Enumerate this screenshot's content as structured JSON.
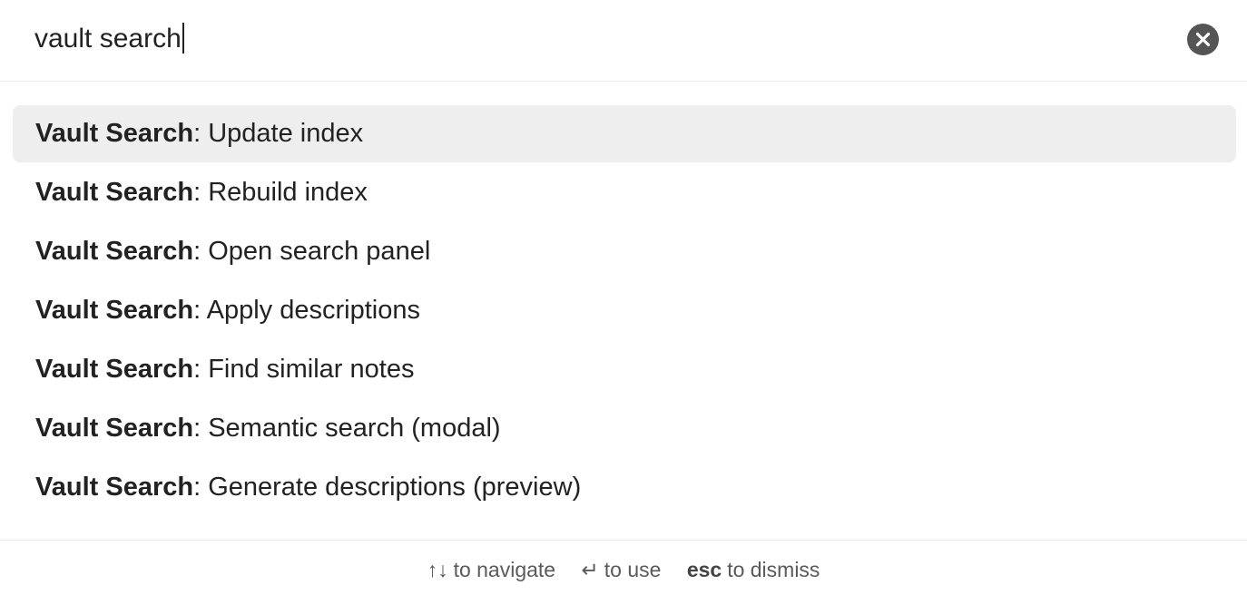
{
  "search": {
    "value": "vault search",
    "clear_icon": "close-icon"
  },
  "results": [
    {
      "prefix": "Vault Search",
      "label": ": Update index",
      "selected": true
    },
    {
      "prefix": "Vault Search",
      "label": ": Rebuild index",
      "selected": false
    },
    {
      "prefix": "Vault Search",
      "label": ": Open search panel",
      "selected": false
    },
    {
      "prefix": "Vault Search",
      "label": ": Apply descriptions",
      "selected": false
    },
    {
      "prefix": "Vault Search",
      "label": ": Find similar notes",
      "selected": false
    },
    {
      "prefix": "Vault Search",
      "label": ": Semantic search (modal)",
      "selected": false
    },
    {
      "prefix": "Vault Search",
      "label": ": Generate descriptions (preview)",
      "selected": false
    }
  ],
  "footer": {
    "navigate": {
      "key": "↑↓",
      "text": "to navigate"
    },
    "use": {
      "key": "↵",
      "text": "to use"
    },
    "dismiss": {
      "key": "esc",
      "text": "to dismiss"
    }
  },
  "colors": {
    "selected_bg": "#eeeeee",
    "clear_button": "#555555",
    "text": "#222222",
    "footer_text": "#5a5a5a"
  }
}
